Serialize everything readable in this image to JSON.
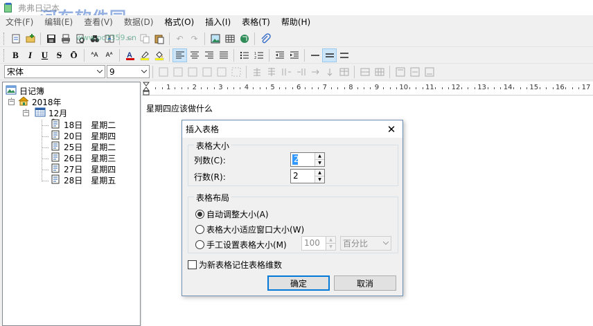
{
  "app": {
    "title": "弗弗日记本",
    "watermark": "河东软件园",
    "watermark_url": "www.pc0359.cn"
  },
  "menu": [
    {
      "label": "文件(F)"
    },
    {
      "label": "编辑(E)"
    },
    {
      "label": "查看(V)"
    },
    {
      "label": "数据(D)"
    },
    {
      "label": "格式(O)"
    },
    {
      "label": "插入(I)"
    },
    {
      "label": "表格(T)"
    },
    {
      "label": "帮助(H)"
    }
  ],
  "toolbar_format": {
    "bold": "B",
    "italic": "I",
    "underline": "U",
    "strike": "S",
    "overline": "Ō",
    "font_color": "#d00000",
    "highlight_color": "#ffff00"
  },
  "font": {
    "family": "宋体",
    "size": "9"
  },
  "tree": {
    "root": "日记簿",
    "year": "2018年",
    "month": "12月",
    "entries": [
      {
        "day": "18日",
        "weekday": "星期二"
      },
      {
        "day": "20日",
        "weekday": "星期四"
      },
      {
        "day": "25日",
        "weekday": "星期二"
      },
      {
        "day": "26日",
        "weekday": "星期三"
      },
      {
        "day": "27日",
        "weekday": "星期四"
      },
      {
        "day": "28日",
        "weekday": "星期五"
      }
    ]
  },
  "ruler": {
    "labels": [
      "1",
      "2",
      "3",
      "4",
      "5",
      "6",
      "7",
      "8",
      "9",
      "10",
      "11",
      "12",
      "13",
      "14",
      "15",
      "16",
      "17"
    ]
  },
  "editor": {
    "text": "星期四应该做什么"
  },
  "dialog": {
    "title": "插入表格",
    "size_group": "表格大小",
    "columns_label": "列数(C):",
    "columns_value": "2",
    "rows_label": "行数(R):",
    "rows_value": "2",
    "layout_group": "表格布局",
    "radio_auto": "自动调整大小(A)",
    "radio_window": "表格大小适应窗口大小(W)",
    "radio_manual": "手工设置表格大小(M)",
    "manual_value": "100",
    "manual_unit": "百分比",
    "remember": "为新表格记住表格维数",
    "ok": "确定",
    "cancel": "取消",
    "selected_radio": "auto",
    "remember_checked": false
  }
}
